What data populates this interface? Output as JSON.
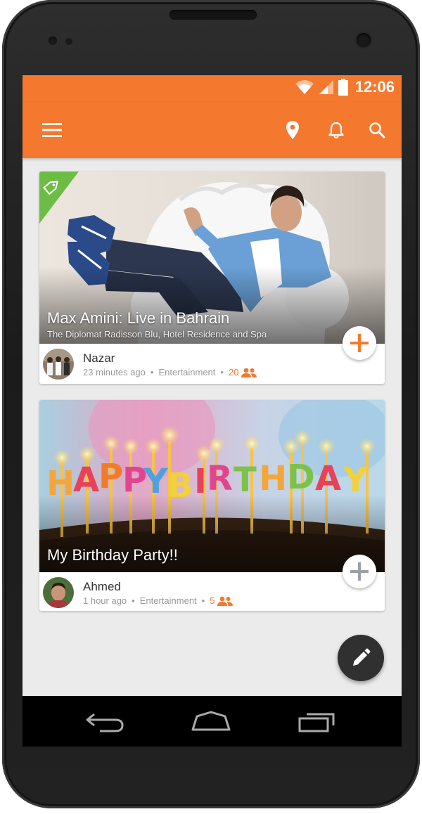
{
  "statusbar": {
    "time": "12:06"
  },
  "colors": {
    "accent": "#f4792f",
    "fab": "#303030",
    "tag": "#6dbd45"
  },
  "appbar": {
    "icons": [
      "menu-icon",
      "location-pin-icon",
      "bell-icon",
      "search-icon"
    ]
  },
  "cards": [
    {
      "title": "Max Amini: Live in Bahrain",
      "venue": "The Diplomat Radisson Blu, Hotel Residence and Spa",
      "author": "Nazar",
      "time": "23 minutes ago",
      "category": "Entertainment",
      "attendees": "20",
      "tagged": true
    },
    {
      "title": "My Birthday Party!!",
      "author": "Ahmed",
      "time": "1 hour ago",
      "category": "Entertainment",
      "attendees": "5",
      "tagged": false
    }
  ],
  "birthday_letters": [
    "H",
    "A",
    "P",
    "P",
    "Y",
    "B",
    "I",
    "R",
    "T",
    "H",
    "D",
    "A",
    "Y"
  ],
  "navbar": {
    "icons": [
      "back-icon",
      "home-icon",
      "recents-icon"
    ]
  }
}
